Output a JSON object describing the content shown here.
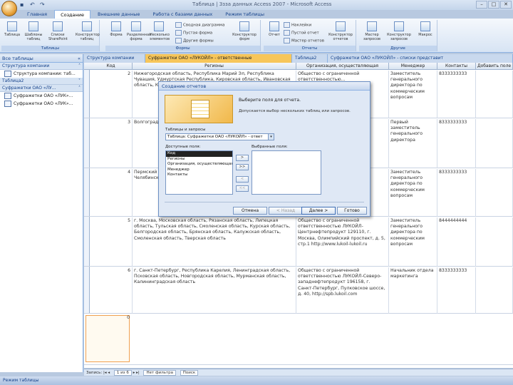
{
  "window": {
    "title": "Таблица | Ззза данных Access 2007 - Microsoft Access"
  },
  "quick_access": [
    "save-icon",
    "undo-icon",
    "redo-icon"
  ],
  "ribbon": {
    "tabs": [
      "Главная",
      "Создание",
      "Внешние данные",
      "Работа с базами данных",
      "Режим таблицы"
    ],
    "groups": [
      {
        "label": "Таблицы",
        "buttons": [
          "Таблица",
          "Шаблоны таблиц",
          "Списки SharePoint",
          "Конструктор таблиц"
        ]
      },
      {
        "label": "Формы",
        "buttons": [
          "Форма",
          "Разделенная форма",
          "Несколько элементов"
        ],
        "small": [
          "Сводная диаграмма",
          "Пустая форма",
          "Другие формы",
          "Конструктор форм"
        ]
      },
      {
        "label": "Отчеты",
        "buttons": [
          "Отчет"
        ],
        "small": [
          "Наклейки",
          "Пустой отчет",
          "Мастер отчетов",
          "Конструктор отчетов"
        ]
      },
      {
        "label": "Другие",
        "buttons": [
          "Мастер запросов",
          "Конструктор запросов",
          "Макрос"
        ]
      }
    ]
  },
  "nav_pane": {
    "header": "Все таблицы",
    "groups": [
      {
        "label": "Структура компании",
        "items": [
          "Структура компании: таб..."
        ]
      },
      {
        "label": "Таблица2",
        "items": []
      },
      {
        "label": "Суфражетки ОАО «ЛУ...",
        "items": [
          "Суфражетки ОАО «ЛУК»...",
          "Суфражетки ОАО «ЛУК»..."
        ]
      }
    ]
  },
  "doc_tabs": [
    "Структура компании",
    "Суфражетки ОАО «ЛУКОЙЛ» - ответственные",
    "Таблица2",
    "Суфражетки ОАО «ЛУКОЙЛ» - списки представит"
  ],
  "grid": {
    "columns": [
      "Код",
      "Регионы",
      "Организация, осуществляющая",
      "Менеджер",
      "Контакты",
      "Добавить поле"
    ],
    "rows": [
      {
        "id": "2",
        "region": "Нижегородская область, Республика Марий Эл, Республика Чувашия, Удмуртская Республика, Кировская область, Ивановская область, Костромская...",
        "org": "Общество с ограниченной ответственностью...",
        "manager": "Заместитель генерального директора по коммерческим вопросам",
        "contact": "8333333333"
      },
      {
        "id": "3",
        "region": "Волгоградская область, Астраханская область, Воронежская...",
        "org": "Общество с ограниченной ответственностью...",
        "manager": "Первый заместитель генерального директора",
        "contact": "8333333333"
      },
      {
        "id": "4",
        "region": "Пермский край, Свердловская область, Курганская область, Челябинская...",
        "org": "Общество с ограниченной ответственностью...",
        "manager": "Заместитель генерального директора по коммерческим вопросам",
        "contact": "8333333333"
      },
      {
        "id": "5",
        "region": "г. Москва, Московская область, Рязанская область, Липецкая область, Тульская область, Смоленская область, Курская область, Белгородская область, Брянская область, Калужская область, Смоленская область, Тверская область",
        "org": "Общество с ограниченной ответственностью ЛУКОЙЛ-Центрнефтепродукт 129110, г. Москва, Олимпийский проспект, д. 5, стр.1 http://www.lukoil-lukoil.ru",
        "manager": "Заместитель генерального директора по коммерческим вопросам",
        "contact": "8444444444"
      },
      {
        "id": "6",
        "region": "г. Санкт-Петербург, Республика Карелия, Ленинградская область, Псковская область, Новгородская область, Мурманская область, Калининградская область",
        "org": "Общество с ограниченной ответственностью ЛУКОЙЛ-Северо-западнефтепродукт 196158, г. Санкт-Петербург, Пулковское шоссе, д. 40, http://spb.lukoil.com",
        "manager": "Начальник отдела маркетинга",
        "contact": "8333333333"
      }
    ],
    "new_row_id": "0"
  },
  "record_nav": {
    "label": "Запись:",
    "position": "1 из 6",
    "filter": "Нет фильтра",
    "search": "Поиск"
  },
  "status": {
    "text": "Режим таблицы"
  },
  "dialog": {
    "title": "Создание отчетов",
    "question": "Выберите поля для отчета.",
    "hint": "Допускается выбор нескольких таблиц или запросов.",
    "table_label": "Таблицы и запросы",
    "table_value": "Таблица: Суфражетки ОАО «ЛУКОЙЛ» - ответ",
    "available_label": "Доступные поля:",
    "selected_label": "Выбранные поля:",
    "available_fields": [
      "Код",
      "Регионы",
      "Организация, осуществляющая...",
      "Менеджер",
      "Контакты"
    ],
    "selected_fields": [],
    "move_buttons": [
      ">",
      ">>",
      "<",
      "<<"
    ],
    "buttons": {
      "cancel": "Отмена",
      "back": "< Назад",
      "next": "Далее >",
      "finish": "Готово"
    }
  }
}
